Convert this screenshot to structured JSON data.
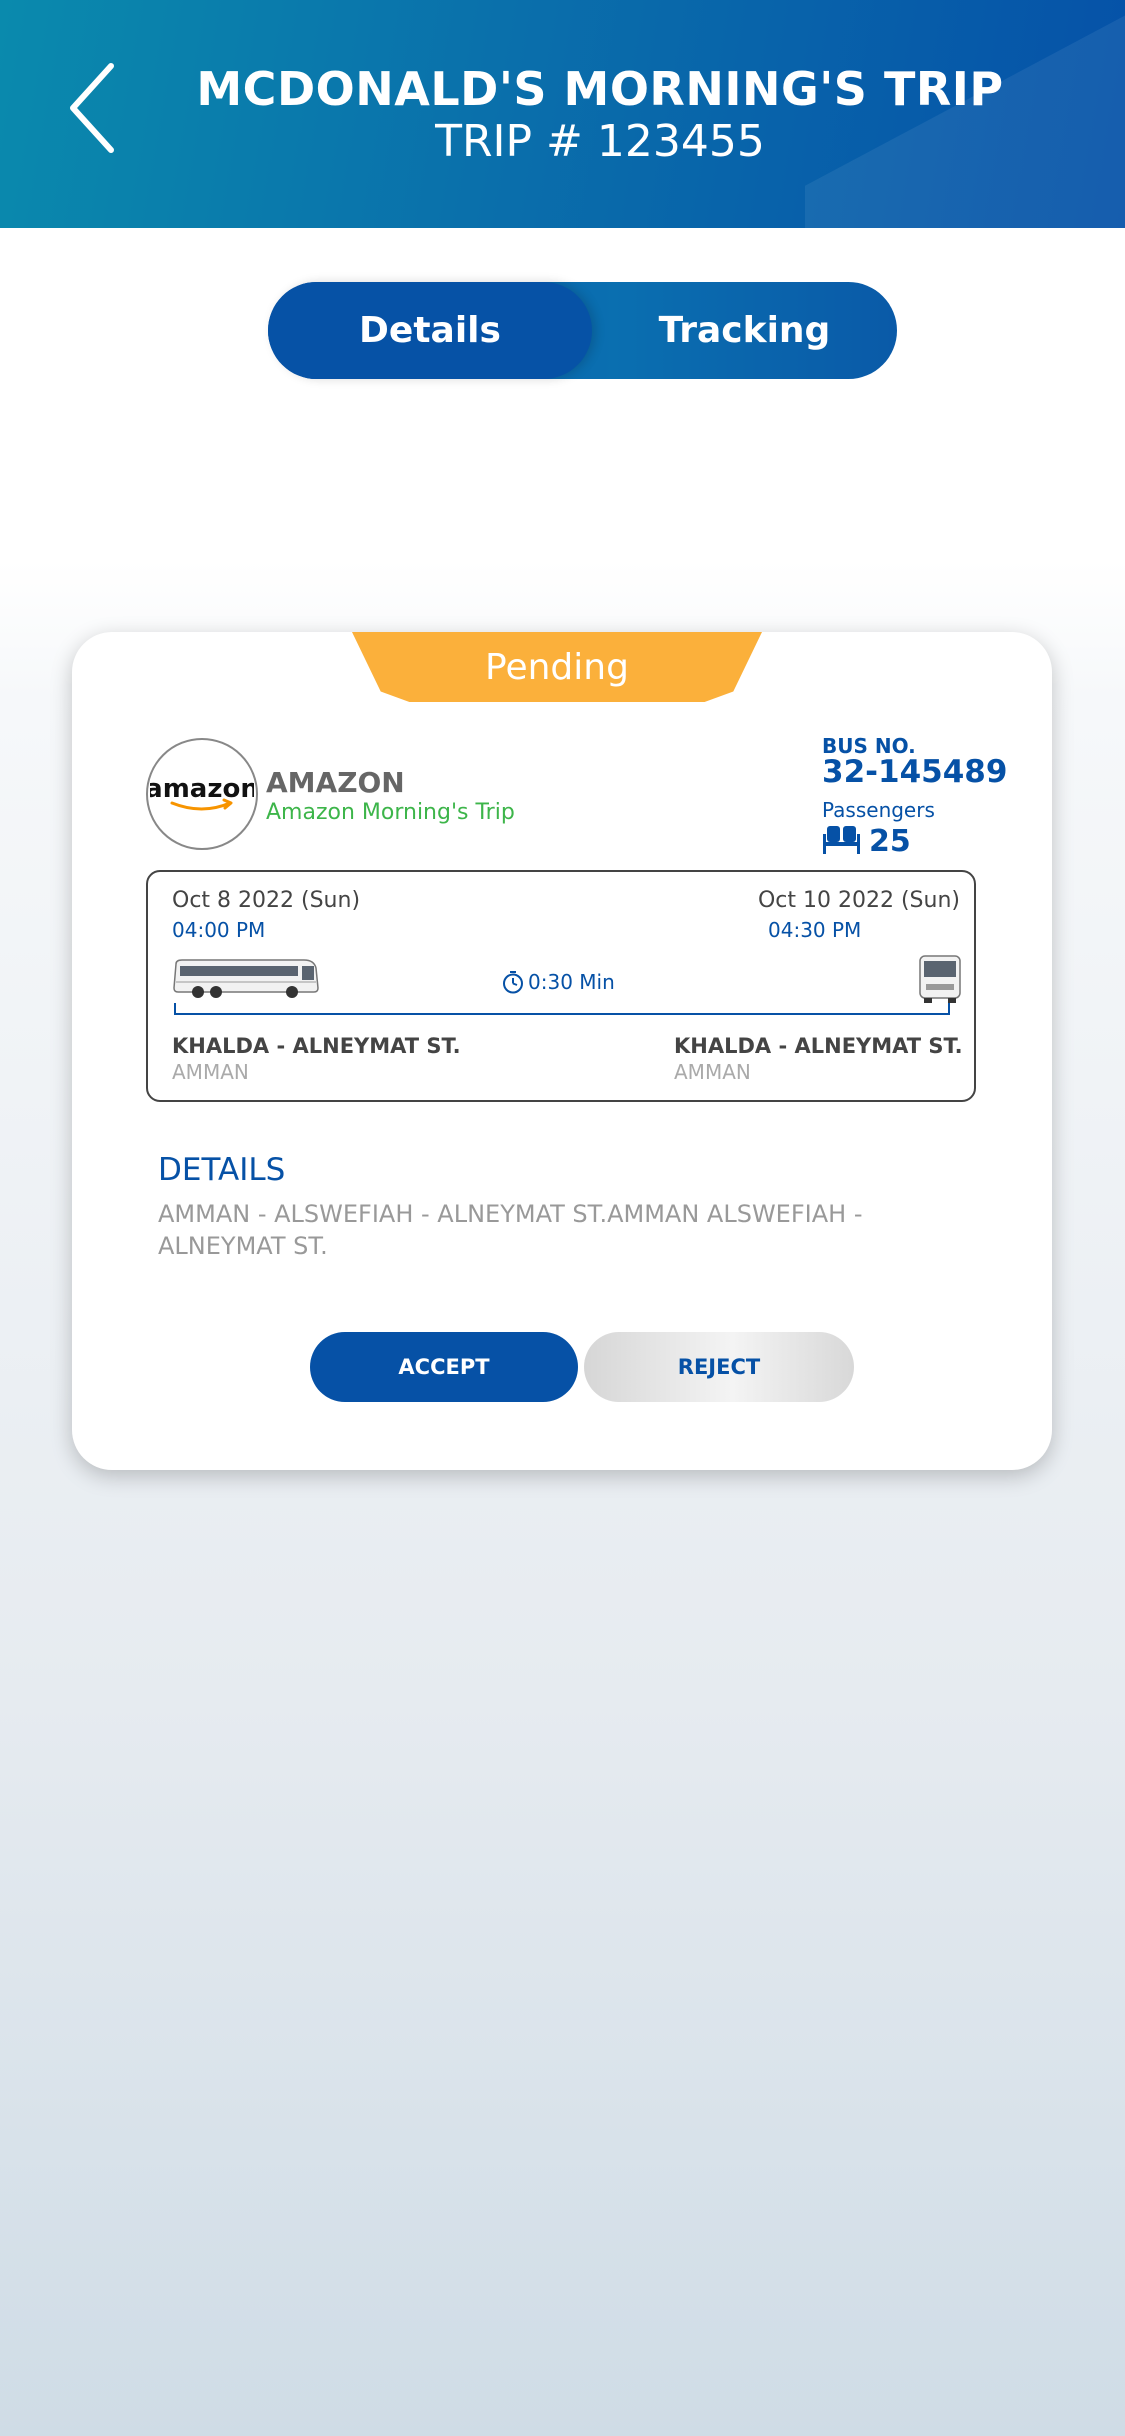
{
  "header": {
    "title": "MCDONALD'S MORNING'S TRIP",
    "subtitle": "TRIP # 123455",
    "back_icon": "chevron-left-icon"
  },
  "tabs": [
    {
      "label": "Details",
      "active": true
    },
    {
      "label": "Tracking",
      "active": false
    }
  ],
  "card": {
    "status": "Pending",
    "company": {
      "logo_text": "amazon",
      "name": "AMAZON",
      "trip_name": "Amazon Morning's Trip"
    },
    "bus": {
      "label": "BUS NO.",
      "number": "32-145489",
      "passengers_label": "Passengers",
      "passengers": "25",
      "seat_icon": "seat-icon"
    },
    "route": {
      "departure_date": "Oct 8 2022 (Sun)",
      "departure_time": "04:00 PM",
      "arrival_date": "Oct 10 2022 (Sun)",
      "arrival_time": "04:30 PM",
      "duration": "0:30 Min",
      "departure_place": "KHALDA - ALNEYMAT ST.",
      "departure_city": "AMMAN",
      "arrival_place": "KHALDA - ALNEYMAT ST.",
      "arrival_city": "AMMAN"
    },
    "details": {
      "heading": "DETAILS",
      "text": "AMMAN - ALSWEFIAH - ALNEYMAT ST.AMMAN ALSWEFIAH - ALNEYMAT ST."
    },
    "actions": {
      "accept": "ACCEPT",
      "reject": "REJECT"
    }
  },
  "colors": {
    "primary": "#0651a6",
    "status_pending": "#fbb03b",
    "trip_name_green": "#3db54a",
    "amazon_arrow": "#f79400"
  }
}
